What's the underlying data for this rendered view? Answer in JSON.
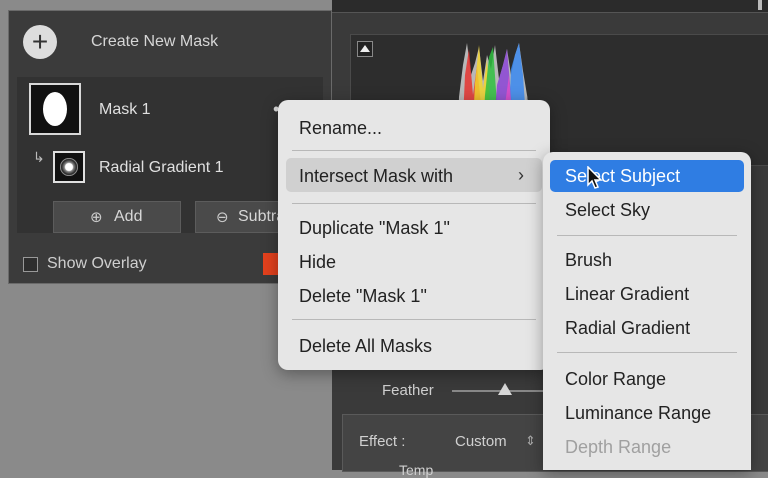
{
  "masks_panel": {
    "create_label": "Create New Mask",
    "mask": {
      "name": "Mask 1"
    },
    "component": {
      "name": "Radial Gradient 1"
    },
    "add_label": "Add",
    "subtract_label": "Subtra",
    "show_overlay_label": "Show Overlay",
    "overlay_color": "#e3411d"
  },
  "context_menu": {
    "rename": "Rename...",
    "intersect": "Intersect Mask with",
    "duplicate": "Duplicate \"Mask 1\"",
    "hide": "Hide",
    "delete": "Delete \"Mask 1\"",
    "delete_all": "Delete All Masks"
  },
  "submenu": {
    "select_subject": "Select Subject",
    "select_sky": "Select Sky",
    "brush": "Brush",
    "linear_gradient": "Linear Gradient",
    "radial_gradient": "Radial Gradient",
    "color_range": "Color Range",
    "luminance_range": "Luminance Range",
    "depth_range": "Depth Range",
    "highlight_color": "#2f7de3"
  },
  "adjustments": {
    "feather_label": "Feather",
    "effect_label": "Effect :",
    "effect_value": "Custom",
    "temp_label": "Temp"
  }
}
